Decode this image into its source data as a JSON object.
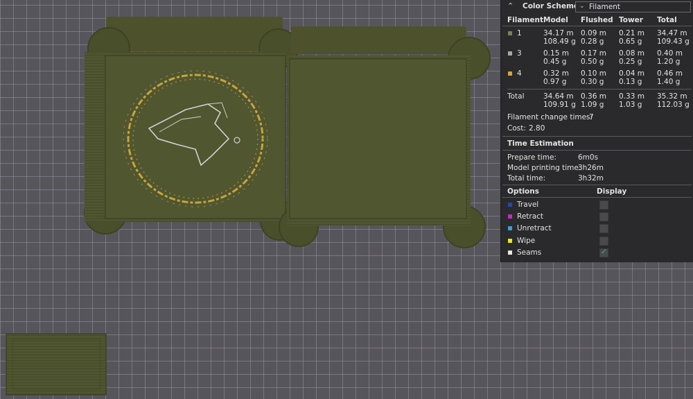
{
  "panel": {
    "color_scheme_label": "Color Scheme",
    "color_scheme_value": "Filament",
    "table": {
      "headers": [
        "Filament",
        "Model",
        "Flushed",
        "Tower",
        "Total"
      ],
      "rows": [
        {
          "id": "1",
          "color": "#7f7f5c",
          "model": [
            "34.17 m",
            "108.49 g"
          ],
          "flushed": [
            "0.09 m",
            "0.28 g"
          ],
          "tower": [
            "0.21 m",
            "0.65 g"
          ],
          "total": [
            "34.47 m",
            "109.43 g"
          ]
        },
        {
          "id": "3",
          "color": "#a8a8a8",
          "model": [
            "0.15 m",
            "0.45 g"
          ],
          "flushed": [
            "0.17 m",
            "0.50 g"
          ],
          "tower": [
            "0.08 m",
            "0.25 g"
          ],
          "total": [
            "0.40 m",
            "1.20 g"
          ]
        },
        {
          "id": "4",
          "color": "#d9a23a",
          "model": [
            "0.32 m",
            "0.97 g"
          ],
          "flushed": [
            "0.10 m",
            "0.30 g"
          ],
          "tower": [
            "0.04 m",
            "0.13 g"
          ],
          "total": [
            "0.46 m",
            "1.40 g"
          ]
        }
      ],
      "total_row": {
        "label": "Total",
        "model": [
          "34.64 m",
          "109.91 g"
        ],
        "flushed": [
          "0.36 m",
          "1.09 g"
        ],
        "tower": [
          "0.33 m",
          "1.03 g"
        ],
        "total": [
          "35.32 m",
          "112.03 g"
        ]
      }
    },
    "filament_change": {
      "label": "Filament change times:",
      "value": "7"
    },
    "cost": {
      "label": "Cost:",
      "value": "2.80"
    },
    "time_estimation": {
      "title": "Time Estimation",
      "items": [
        {
          "label": "Prepare time:",
          "value": "6m0s"
        },
        {
          "label": "Model printing time:",
          "value": "3h26m"
        },
        {
          "label": "Total time:",
          "value": "3h32m"
        }
      ]
    },
    "options": {
      "header": "Options",
      "display_header": "Display",
      "items": [
        {
          "label": "Travel",
          "color": "#2b44a8",
          "checked": false
        },
        {
          "label": "Retract",
          "color": "#c52bc0",
          "checked": false
        },
        {
          "label": "Unretract",
          "color": "#3d9ed6",
          "checked": false
        },
        {
          "label": "Wipe",
          "color": "#e8e81a",
          "checked": false
        },
        {
          "label": "Seams",
          "color": "#e8e8e8",
          "checked": true
        }
      ]
    }
  },
  "colors": {
    "viewport_bg": "#57555c",
    "model_green": "#4f5530",
    "gold_inlay": "#c9a43a",
    "silver_inlay": "#cfcfcf",
    "panel_bg": "#2a2a2c"
  }
}
